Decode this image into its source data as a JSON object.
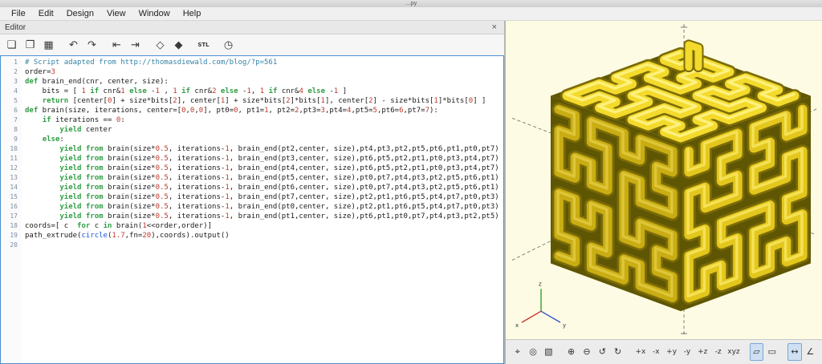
{
  "window": {
    "title": "…py"
  },
  "menu": {
    "items": [
      "File",
      "Edit",
      "Design",
      "View",
      "Window",
      "Help"
    ]
  },
  "editor": {
    "panel_title": "Editor",
    "close_glyph": "×",
    "toolbar": [
      {
        "name": "new-file-icon",
        "glyph": "❏"
      },
      {
        "name": "open-file-icon",
        "glyph": "❐"
      },
      {
        "name": "save-file-icon",
        "glyph": "▦"
      },
      {
        "name": "undo-icon",
        "glyph": "↶",
        "gap": true
      },
      {
        "name": "redo-icon",
        "glyph": "↷"
      },
      {
        "name": "unindent-icon",
        "glyph": "⇤",
        "gap": true
      },
      {
        "name": "indent-icon",
        "glyph": "⇥"
      },
      {
        "name": "preview-icon",
        "glyph": "◇",
        "gap": true
      },
      {
        "name": "render-icon",
        "glyph": "◆"
      },
      {
        "name": "export-stl-icon",
        "glyph": "STL",
        "gap": true
      },
      {
        "name": "animate-icon",
        "glyph": "◷",
        "gap": true
      }
    ],
    "syntax_colors": {
      "comment": "#3584a6",
      "keyword": "#2f9e44",
      "number": "#c0392b",
      "builtin": "#1a56db",
      "default": "#1b1b1b",
      "gutter": "#7b8ea6"
    },
    "lines": [
      "# Script adapted from http://thomasdiewald.com/blog/?p=561",
      "order=3",
      "def brain_end(cnr, center, size):",
      "    bits = [ 1 if cnr&1 else -1 , 1 if cnr&2 else -1, 1 if cnr&4 else -1 ]",
      "    return [center[0] + size*bits[2], center[1] + size*bits[2]*bits[1], center[2] - size*bits[1]*bits[0] ]",
      "def brain(size, iterations, center=[0,0,0], pt0=0, pt1=1, pt2=2,pt3=3,pt4=4,pt5=5,pt6=6,pt7=7):",
      "    if iterations == 0:",
      "        yield center",
      "    else:",
      "        yield from brain(size*0.5, iterations-1, brain_end(pt2,center, size),pt4,pt3,pt2,pt5,pt6,pt1,pt0,pt7)",
      "        yield from brain(size*0.5, iterations-1, brain_end(pt3,center, size),pt6,pt5,pt2,pt1,pt0,pt3,pt4,pt7)",
      "        yield from brain(size*0.5, iterations-1, brain_end(pt4,center, size),pt6,pt5,pt2,pt1,pt0,pt3,pt4,pt7)",
      "        yield from brain(size*0.5, iterations-1, brain_end(pt5,center, size),pt0,pt7,pt4,pt3,pt2,pt5,pt6,pt1)",
      "        yield from brain(size*0.5, iterations-1, brain_end(pt6,center, size),pt0,pt7,pt4,pt3,pt2,pt5,pt6,pt1)",
      "        yield from brain(size*0.5, iterations-1, brain_end(pt7,center, size),pt2,pt1,pt6,pt5,pt4,pt7,pt0,pt3)",
      "        yield from brain(size*0.5, iterations-1, brain_end(pt0,center, size),pt2,pt1,pt6,pt5,pt4,pt7,pt0,pt3)",
      "        yield from brain(size*0.5, iterations-1, brain_end(pt1,center, size),pt6,pt1,pt0,pt7,pt4,pt3,pt2,pt5)",
      "coords=[ c  for c in brain(1<<order,order)]",
      "path_extrude(circle(1.7,fn=20),coords).output()",
      ""
    ]
  },
  "viewport": {
    "background": "#fdfbe3",
    "model_colors": {
      "top": "#f3da2c",
      "right": "#e3c71d",
      "left": "#c9ad13",
      "crevice": "#5f5604",
      "tube_outline": "#7a6b07",
      "highlight": "#fff385"
    },
    "axis_labels": {
      "x": "x",
      "y": "y",
      "z": "z"
    },
    "toolbar": [
      {
        "name": "show-axes-icon",
        "glyph": "⌖"
      },
      {
        "name": "show-crosshairs-icon",
        "glyph": "◎"
      },
      {
        "name": "select-zoom-icon",
        "glyph": "▧"
      },
      {
        "name": "zoom-in-icon",
        "glyph": "⊕",
        "gap": true
      },
      {
        "name": "zoom-out-icon",
        "glyph": "⊖"
      },
      {
        "name": "reset-view-icon",
        "glyph": "↺"
      },
      {
        "name": "rotate-view-icon",
        "glyph": "↻"
      },
      {
        "name": "view-right-icon",
        "glyph": "+x",
        "gap": true
      },
      {
        "name": "view-left-icon",
        "glyph": "-x"
      },
      {
        "name": "view-front-icon",
        "glyph": "+y"
      },
      {
        "name": "view-back-icon",
        "glyph": "-y"
      },
      {
        "name": "view-top-icon",
        "glyph": "+z"
      },
      {
        "name": "view-bottom-icon",
        "glyph": "-z"
      },
      {
        "name": "view-diagonal-icon",
        "glyph": "xyz"
      },
      {
        "name": "perspective-icon",
        "glyph": "▱",
        "active": true,
        "gap": true
      },
      {
        "name": "orthogonal-icon",
        "glyph": "▭"
      },
      {
        "name": "measure-distance-icon",
        "glyph": "↔",
        "active": true,
        "gap": true
      },
      {
        "name": "measure-angle-icon",
        "glyph": "∠"
      }
    ]
  }
}
